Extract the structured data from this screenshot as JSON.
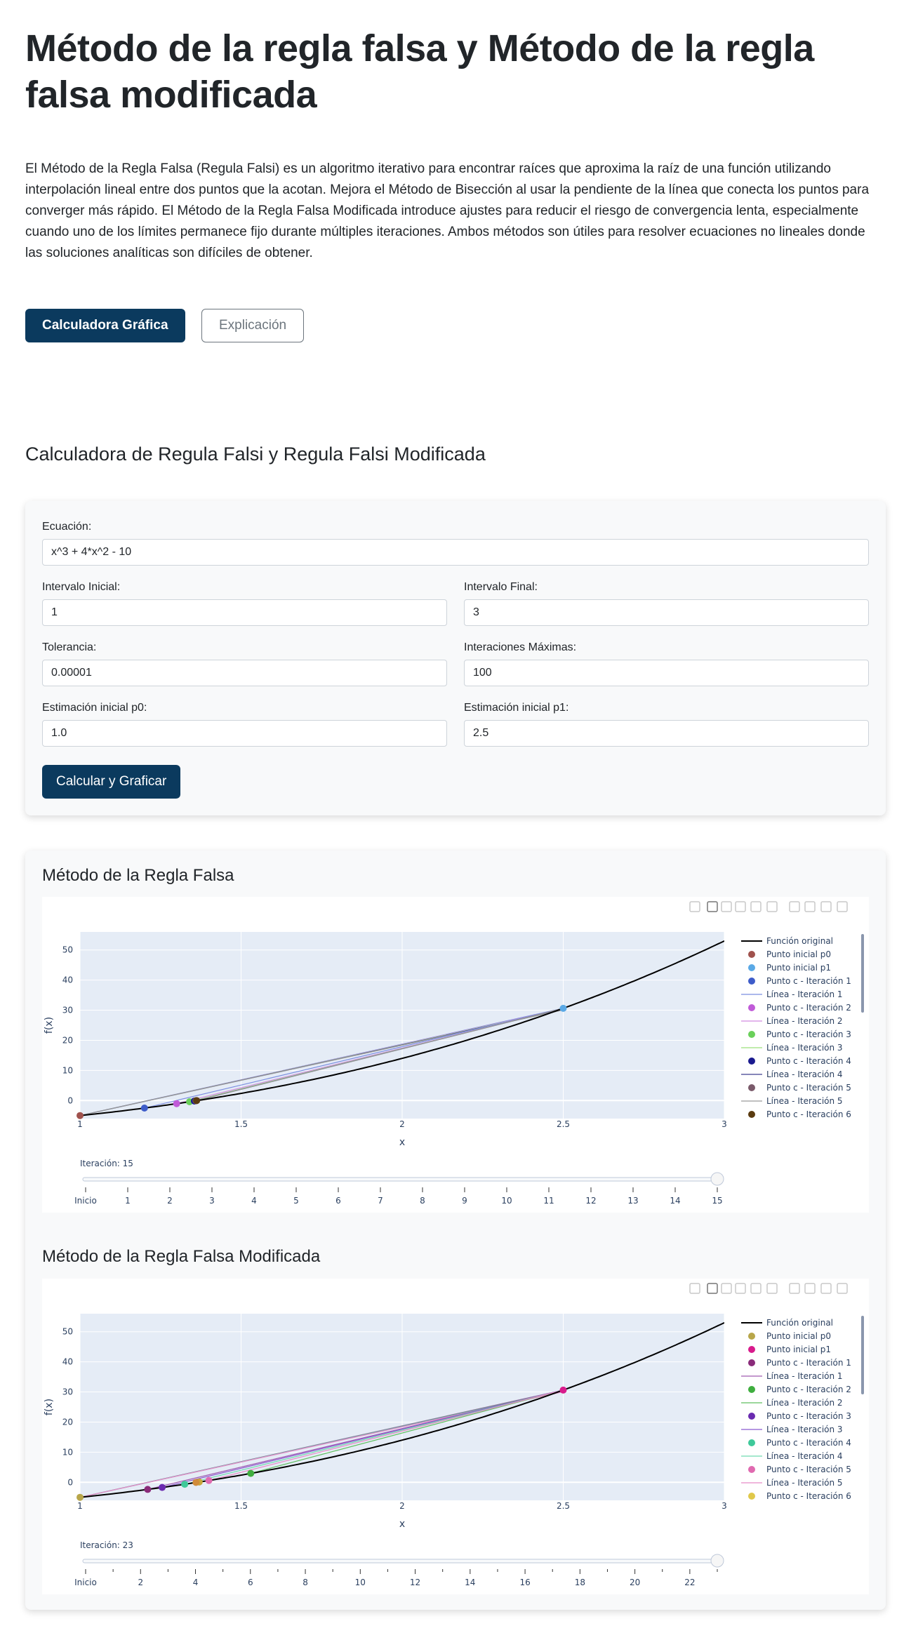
{
  "page": {
    "title": "Método de la regla falsa y Método de la regla falsa modificada",
    "intro": "El Método de la Regla Falsa (Regula Falsi) es un algoritmo iterativo para encontrar raíces que aproxima la raíz de una función utilizando interpolación lineal entre dos puntos que la acotan. Mejora el Método de Bisección al usar la pendiente de la línea que conecta los puntos para converger más rápido. El Método de la Regla Falsa Modificada introduce ajustes para reducir el riesgo de convergencia lenta, especialmente cuando uno de los límites permanece fijo durante múltiples iteraciones. Ambos métodos son útiles para resolver ecuaciones no lineales donde las soluciones analíticas son difíciles de obtener.",
    "tab_calculator": "Calculadora Gráfica",
    "tab_explanation": "Explicación"
  },
  "calculator": {
    "heading": "Calculadora de Regula Falsi y Regula Falsi Modificada",
    "equation_label": "Ecuación:",
    "equation_value": "x^3 + 4*x^2 - 10",
    "interval_start_label": "Intervalo Inicial:",
    "interval_start_value": "1",
    "interval_end_label": "Intervalo Final:",
    "interval_end_value": "3",
    "tolerance_label": "Tolerancia:",
    "tolerance_value": "0.00001",
    "max_iter_label": "Interaciones Máximas:",
    "max_iter_value": "100",
    "p0_label": "Estimación inicial p0:",
    "p0_value": "1.0",
    "p1_label": "Estimación inicial p1:",
    "p1_value": "2.5",
    "submit_label": "Calcular y Graficar"
  },
  "chart_data": [
    {
      "type": "line",
      "title": "Método de la Regla Falsa",
      "xlabel": "x",
      "ylabel": "f(x)",
      "xlim": [
        1,
        3
      ],
      "ylim": [
        -6,
        56
      ],
      "xticks": [
        "1",
        "1.5",
        "2",
        "2.5",
        "3"
      ],
      "yticks": [
        "0",
        "10",
        "20",
        "30",
        "40",
        "50"
      ],
      "function": "x^3 + 4*x^2 - 10",
      "p0": {
        "x": 1.0,
        "y": -5
      },
      "p1": {
        "x": 2.5,
        "y": 30.625
      },
      "iteration_points": [
        {
          "x": 1.2,
          "y": -2.51,
          "color": "#3e5cc9"
        },
        {
          "x": 1.3,
          "y": -1.04,
          "color": "#c05bd8"
        },
        {
          "x": 1.34,
          "y": -0.41,
          "color": "#6ad05a"
        },
        {
          "x": 1.355,
          "y": -0.16,
          "color": "#1a1a8f"
        },
        {
          "x": 1.36,
          "y": -0.06,
          "color": "#7a5a6a"
        },
        {
          "x": 1.362,
          "y": -0.02,
          "color": "#5a3b10"
        }
      ],
      "line_colors": [
        "#7b8de0",
        "#d28be0",
        "#9be07b",
        "#3d3d8f",
        "#9a9a9a"
      ],
      "legend": [
        {
          "label": "Función original",
          "kind": "line",
          "color": "#000000"
        },
        {
          "label": "Punto inicial p0",
          "kind": "dot",
          "color": "#a0524d"
        },
        {
          "label": "Punto inicial p1",
          "kind": "dot",
          "color": "#5aa9e6"
        },
        {
          "label": "Punto c - Iteración 1",
          "kind": "dot",
          "color": "#3e5cc9"
        },
        {
          "label": "Línea - Iteración 1",
          "kind": "line",
          "color": "#7b8de0"
        },
        {
          "label": "Punto c - Iteración 2",
          "kind": "dot",
          "color": "#c05bd8"
        },
        {
          "label": "Línea - Iteración 2",
          "kind": "line",
          "color": "#d28be0"
        },
        {
          "label": "Punto c - Iteración 3",
          "kind": "dot",
          "color": "#6ad05a"
        },
        {
          "label": "Línea - Iteración 3",
          "kind": "line",
          "color": "#9be07b"
        },
        {
          "label": "Punto c - Iteración 4",
          "kind": "dot",
          "color": "#1a1a8f"
        },
        {
          "label": "Línea - Iteración 4",
          "kind": "line",
          "color": "#3d3d8f"
        },
        {
          "label": "Punto c - Iteración 5",
          "kind": "dot",
          "color": "#7a5a6a"
        },
        {
          "label": "Línea - Iteración 5",
          "kind": "line",
          "color": "#9a9a9a"
        },
        {
          "label": "Punto c - Iteración 6",
          "kind": "dot",
          "color": "#5a3b10"
        }
      ],
      "slider": {
        "current_label": "Iteración: 15",
        "value": 15,
        "max": 15,
        "labels": [
          "Inicio",
          "1",
          "2",
          "3",
          "4",
          "5",
          "6",
          "7",
          "8",
          "9",
          "10",
          "11",
          "12",
          "13",
          "14",
          "15"
        ],
        "tick_count": 16
      }
    },
    {
      "type": "line",
      "title": "Método de la Regla Falsa Modificada",
      "xlabel": "x",
      "ylabel": "f(x)",
      "xlim": [
        1,
        3
      ],
      "ylim": [
        -6,
        56
      ],
      "xticks": [
        "1",
        "1.5",
        "2",
        "2.5",
        "3"
      ],
      "yticks": [
        "0",
        "10",
        "20",
        "30",
        "40",
        "50"
      ],
      "function": "x^3 + 4*x^2 - 10",
      "p0": {
        "x": 1.0,
        "y": -5
      },
      "p1": {
        "x": 2.5,
        "y": 30.625
      },
      "iteration_points": [
        {
          "x": 1.21,
          "y": -2.37,
          "color": "#8a2b7a"
        },
        {
          "x": 1.53,
          "y": 2.95,
          "color": "#3fae3f"
        },
        {
          "x": 1.255,
          "y": -1.72,
          "color": "#6a2bb0"
        },
        {
          "x": 1.325,
          "y": -0.66,
          "color": "#3fc99a"
        },
        {
          "x": 1.4,
          "y": 0.6,
          "color": "#e06ab0"
        },
        {
          "x": 1.37,
          "y": 0.1,
          "color": "#c8a53a"
        },
        {
          "x": 1.36,
          "y": -0.06,
          "color": "#d18b3a"
        }
      ],
      "line_colors": [
        "#a05bb0",
        "#5fbf5f",
        "#8b5bd0",
        "#6fd9b0",
        "#e88bc8"
      ],
      "legend": [
        {
          "label": "Función original",
          "kind": "line",
          "color": "#000000"
        },
        {
          "label": "Punto inicial p0",
          "kind": "dot",
          "color": "#b8a64a"
        },
        {
          "label": "Punto inicial p1",
          "kind": "dot",
          "color": "#d81b8c"
        },
        {
          "label": "Punto c - Iteración 1",
          "kind": "dot",
          "color": "#8a2b7a"
        },
        {
          "label": "Línea - Iteración 1",
          "kind": "line",
          "color": "#a05bb0"
        },
        {
          "label": "Punto c - Iteración 2",
          "kind": "dot",
          "color": "#3fae3f"
        },
        {
          "label": "Línea - Iteración 2",
          "kind": "line",
          "color": "#5fbf5f"
        },
        {
          "label": "Punto c - Iteración 3",
          "kind": "dot",
          "color": "#6a2bb0"
        },
        {
          "label": "Línea - Iteración 3",
          "kind": "line",
          "color": "#8b5bd0"
        },
        {
          "label": "Punto c - Iteración 4",
          "kind": "dot",
          "color": "#3fc99a"
        },
        {
          "label": "Línea - Iteración 4",
          "kind": "line",
          "color": "#6fd9b0"
        },
        {
          "label": "Punto c - Iteración 5",
          "kind": "dot",
          "color": "#e06ab0"
        },
        {
          "label": "Línea - Iteración 5",
          "kind": "line",
          "color": "#e88bc8"
        },
        {
          "label": "Punto c - Iteración 6",
          "kind": "dot",
          "color": "#e0c84a"
        }
      ],
      "slider": {
        "current_label": "Iteración: 23",
        "value": 23,
        "max": 23,
        "labels": [
          "Inicio",
          "2",
          "4",
          "6",
          "8",
          "10",
          "12",
          "14",
          "16",
          "18",
          "20",
          "22"
        ],
        "tick_count": 24
      }
    }
  ]
}
